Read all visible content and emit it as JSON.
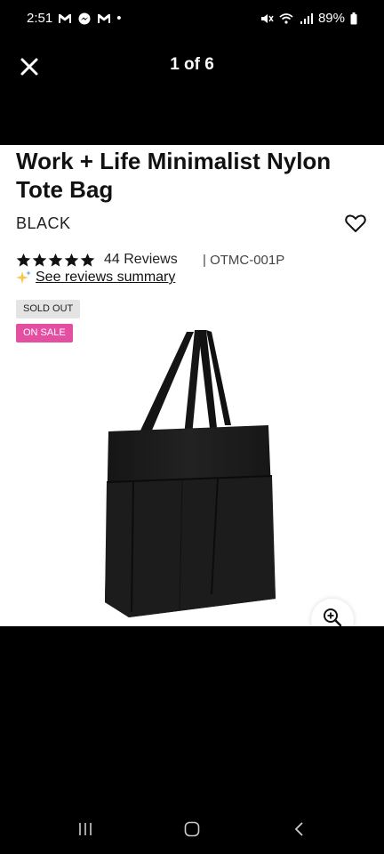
{
  "status_bar": {
    "time": "2:51",
    "notification_icons": [
      "gmail-icon",
      "messenger-icon",
      "gmail-icon"
    ],
    "dot": "•",
    "battery": "89%"
  },
  "viewer": {
    "counter": "1 of 6"
  },
  "product": {
    "title": "Work + Life Minimalist Nylon Tote Bag",
    "color": "BLACK",
    "rating": 5,
    "reviews_label": "44 Reviews",
    "sku": "| OTMC-001P",
    "summary_link": "See reviews summary",
    "badges": {
      "sold_out": "SOLD OUT",
      "on_sale": "ON SALE"
    }
  },
  "colors": {
    "sale_badge": "#e54fa2",
    "soldout_badge": "#e4e4e4",
    "sparkle": "#f2c94c"
  }
}
